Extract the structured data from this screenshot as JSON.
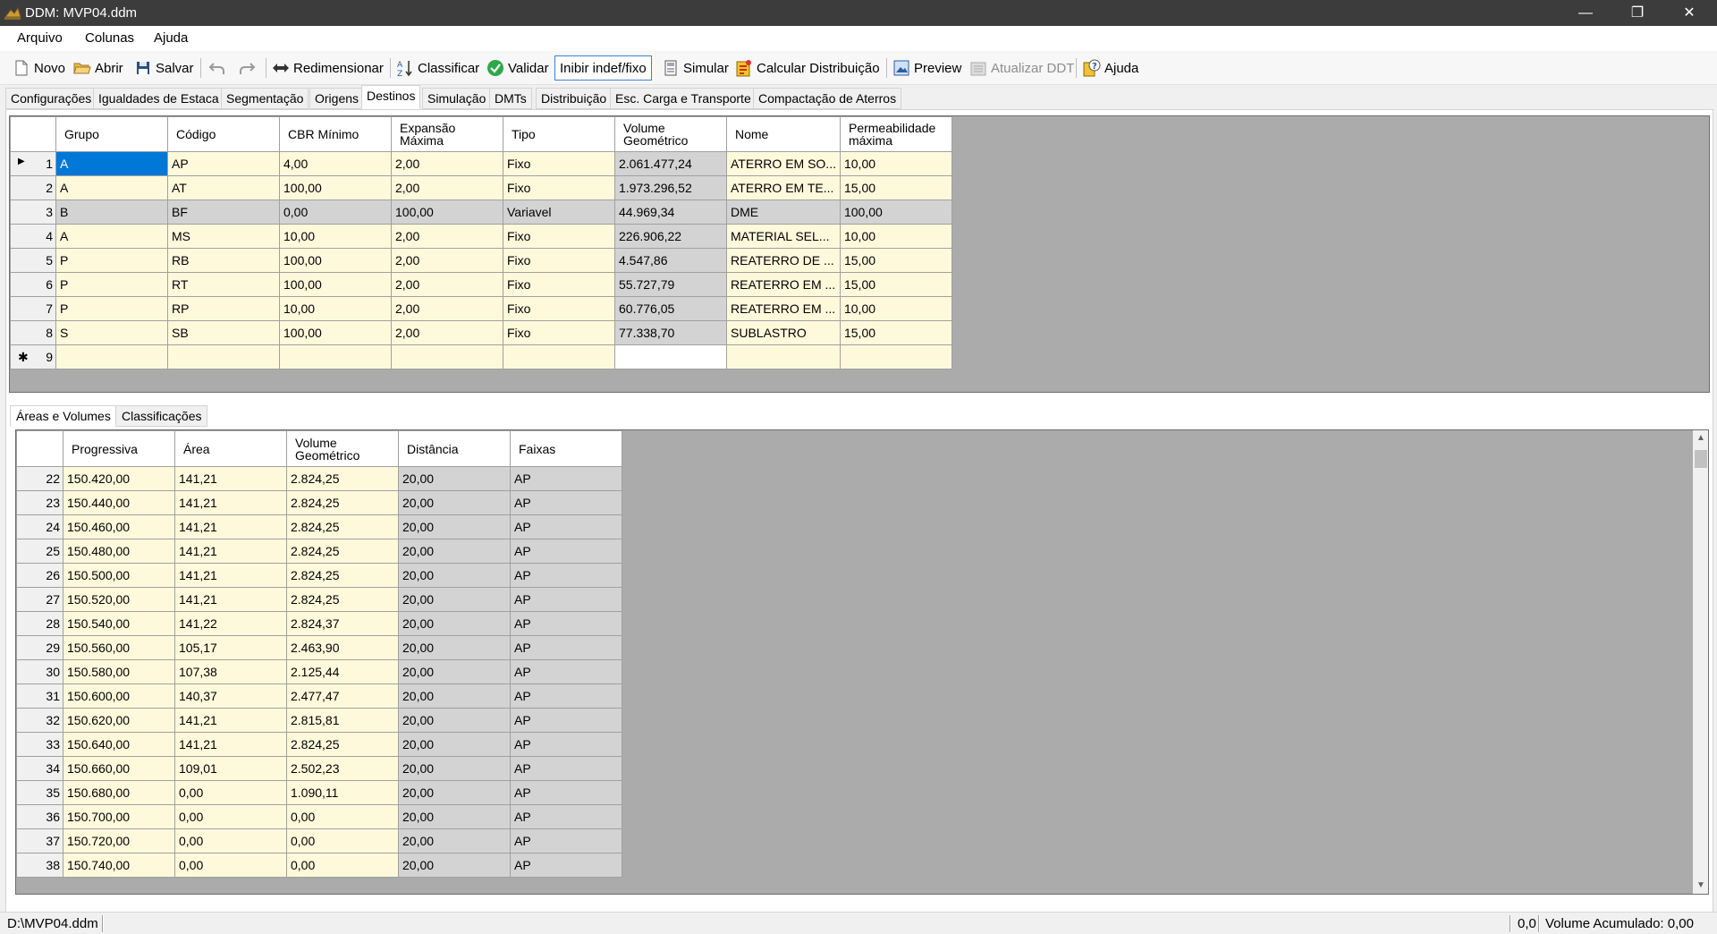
{
  "window": {
    "title": "DDM: MVP04.ddm",
    "minimize": "—",
    "restore": "❐",
    "close": "✕"
  },
  "menu": [
    "Arquivo",
    "Colunas",
    "Ajuda"
  ],
  "toolbar": {
    "novo": "Novo",
    "abrir": "Abrir",
    "salvar": "Salvar",
    "redimensionar": "Redimensionar",
    "classificar": "Classificar",
    "validar": "Validar",
    "inibir": "Inibir indef/fixo",
    "simular": "Simular",
    "calcular": "Calcular Distribuição",
    "preview": "Preview",
    "atualizar": "Atualizar DDT",
    "ajuda": "Ajuda"
  },
  "tabs": [
    "Configurações",
    "Igualdades de Estaca",
    "Segmentação",
    "Origens",
    "Destinos",
    "Simulação",
    "DMTs",
    "Distribuição",
    "Esc. Carga e Transporte",
    "Compactação de Aterros"
  ],
  "active_tab": "Destinos",
  "destinos": {
    "headers": [
      "Grupo",
      "Código",
      "CBR Mínimo",
      "Expansão Máxima",
      "Tipo",
      "Volume Geométrico",
      "Nome",
      "Permeabilidade máxima"
    ],
    "rows": [
      [
        "1",
        "A",
        "AP",
        "4,00",
        "2,00",
        "Fixo",
        "2.061.477,24",
        "ATERRO EM SO...",
        "10,00"
      ],
      [
        "2",
        "A",
        "AT",
        "100,00",
        "2,00",
        "Fixo",
        "1.973.296,52",
        "ATERRO EM TE...",
        "15,00"
      ],
      [
        "3",
        "B",
        "BF",
        "0,00",
        "100,00",
        "Variavel",
        "44.969,34",
        "DME",
        "100,00"
      ],
      [
        "4",
        "A",
        "MS",
        "10,00",
        "2,00",
        "Fixo",
        "226.906,22",
        "MATERIAL SEL...",
        "10,00"
      ],
      [
        "5",
        "P",
        "RB",
        "100,00",
        "2,00",
        "Fixo",
        "4.547,86",
        "REATERRO DE ...",
        "15,00"
      ],
      [
        "6",
        "P",
        "RT",
        "100,00",
        "2,00",
        "Fixo",
        "55.727,79",
        "REATERRO EM ...",
        "15,00"
      ],
      [
        "7",
        "P",
        "RP",
        "10,00",
        "2,00",
        "Fixo",
        "60.776,05",
        "REATERRO EM ...",
        "10,00"
      ],
      [
        "8",
        "S",
        "SB",
        "100,00",
        "2,00",
        "Fixo",
        "77.338,70",
        "SUBLASTRO",
        "15,00"
      ]
    ],
    "new_row": "9"
  },
  "bottom_tabs": [
    "Áreas e Volumes",
    "Classificações"
  ],
  "areas": {
    "headers": [
      "Progressiva",
      "Área",
      "Volume Geométrico",
      "Distância",
      "Faixas"
    ],
    "rows": [
      [
        "22",
        "150.420,00",
        "141,21",
        "2.824,25",
        "20,00",
        "AP"
      ],
      [
        "23",
        "150.440,00",
        "141,21",
        "2.824,25",
        "20,00",
        "AP"
      ],
      [
        "24",
        "150.460,00",
        "141,21",
        "2.824,25",
        "20,00",
        "AP"
      ],
      [
        "25",
        "150.480,00",
        "141,21",
        "2.824,25",
        "20,00",
        "AP"
      ],
      [
        "26",
        "150.500,00",
        "141,21",
        "2.824,25",
        "20,00",
        "AP"
      ],
      [
        "27",
        "150.520,00",
        "141,21",
        "2.824,25",
        "20,00",
        "AP"
      ],
      [
        "28",
        "150.540,00",
        "141,22",
        "2.824,37",
        "20,00",
        "AP"
      ],
      [
        "29",
        "150.560,00",
        "105,17",
        "2.463,90",
        "20,00",
        "AP"
      ],
      [
        "30",
        "150.580,00",
        "107,38",
        "2.125,44",
        "20,00",
        "AP"
      ],
      [
        "31",
        "150.600,00",
        "140,37",
        "2.477,47",
        "20,00",
        "AP"
      ],
      [
        "32",
        "150.620,00",
        "141,21",
        "2.815,81",
        "20,00",
        "AP"
      ],
      [
        "33",
        "150.640,00",
        "141,21",
        "2.824,25",
        "20,00",
        "AP"
      ],
      [
        "34",
        "150.660,00",
        "109,01",
        "2.502,23",
        "20,00",
        "AP"
      ],
      [
        "35",
        "150.680,00",
        "0,00",
        "1.090,11",
        "20,00",
        "AP"
      ],
      [
        "36",
        "150.700,00",
        "0,00",
        "0,00",
        "20,00",
        "AP"
      ],
      [
        "37",
        "150.720,00",
        "0,00",
        "0,00",
        "20,00",
        "AP"
      ],
      [
        "38",
        "150.740,00",
        "0,00",
        "0,00",
        "20,00",
        "AP"
      ]
    ]
  },
  "status": {
    "file": "D:\\MVP04.ddm",
    "coord": "0,0",
    "volume": "Volume Acumulado: 0,00"
  }
}
